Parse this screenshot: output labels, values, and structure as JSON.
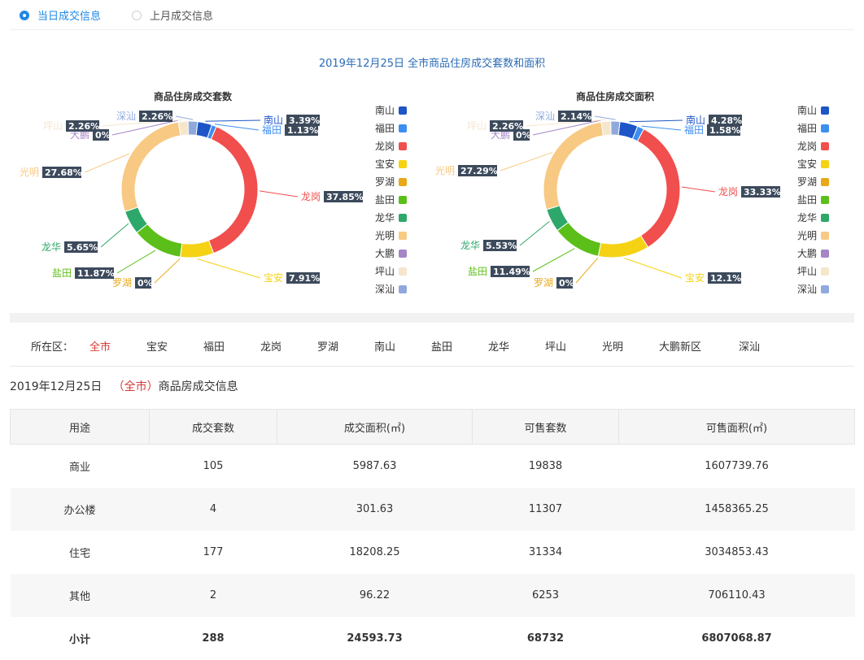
{
  "tabs": [
    {
      "label": "当日成交信息",
      "active": true
    },
    {
      "label": "上月成交信息",
      "active": false
    }
  ],
  "chart_title": "2019年12月25日 全市商品住房成交套数和面积",
  "chart_data": [
    {
      "type": "pie",
      "title": "商品住房成交套数",
      "labels": [
        "南山",
        "福田",
        "龙岗",
        "宝安",
        "罗湖",
        "盐田",
        "龙华",
        "光明",
        "大鹏",
        "坪山",
        "深汕"
      ],
      "values": [
        3.39,
        1.13,
        37.85,
        7.91,
        0,
        11.87,
        5.65,
        27.68,
        0,
        2.26,
        2.26
      ],
      "value_labels": [
        "3.39%",
        "1.13%",
        "37.85%",
        "7.91%",
        "0%",
        "11.87%",
        "5.65%",
        "27.68%",
        "0%",
        "2.26%",
        "2.26%"
      ],
      "legend": "right"
    },
    {
      "type": "pie",
      "title": "商品住房成交面积",
      "labels": [
        "南山",
        "福田",
        "龙岗",
        "宝安",
        "罗湖",
        "盐田",
        "龙华",
        "光明",
        "大鹏",
        "坪山",
        "深汕"
      ],
      "values": [
        4.28,
        1.58,
        33.33,
        12.1,
        0,
        11.49,
        5.53,
        27.29,
        0,
        2.26,
        2.14
      ],
      "value_labels": [
        "4.28%",
        "1.58%",
        "33.33%",
        "12.1%",
        "0%",
        "11.49%",
        "5.53%",
        "27.29%",
        "0%",
        "2.26%",
        "2.14%"
      ],
      "legend": "right"
    }
  ],
  "colors": [
    "#1e55c7",
    "#3d8ef0",
    "#f14e4e",
    "#f5d214",
    "#e8a817",
    "#5cbf19",
    "#2ea86a",
    "#f8c983",
    "#a585c6",
    "#f5e6cc",
    "#8fa9dd"
  ],
  "district_filter": {
    "label": "所在区：",
    "items": [
      "全市",
      "宝安",
      "福田",
      "龙岗",
      "罗湖",
      "南山",
      "盐田",
      "龙华",
      "坪山",
      "光明",
      "大鹏新区",
      "深汕"
    ],
    "active_index": 0
  },
  "info": {
    "date": "2019年12月25日",
    "open_paren": "（",
    "district": "全市",
    "close_paren": "）",
    "suffix": "商品房成交信息"
  },
  "table": {
    "headers": [
      "用途",
      "成交套数",
      "成交面积(㎡)",
      "可售套数",
      "可售面积(㎡)"
    ],
    "rows": [
      [
        "商业",
        "105",
        "5987.63",
        "19838",
        "1607739.76"
      ],
      [
        "办公楼",
        "4",
        "301.63",
        "11307",
        "1458365.25"
      ],
      [
        "住宅",
        "177",
        "18208.25",
        "31334",
        "3034853.43"
      ],
      [
        "其他",
        "2",
        "96.22",
        "6253",
        "706110.43"
      ],
      [
        "小计",
        "288",
        "24593.73",
        "68732",
        "6807068.87"
      ]
    ]
  }
}
